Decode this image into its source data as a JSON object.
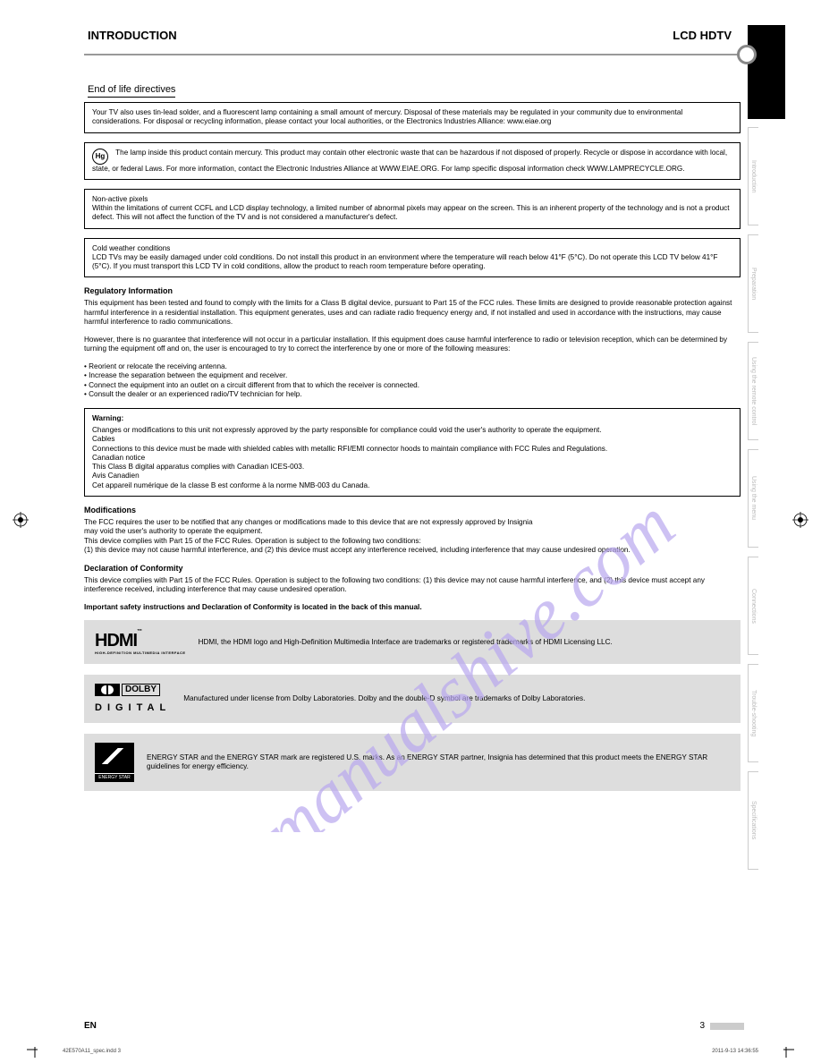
{
  "header": {
    "section": "INTRODUCTION",
    "page_title": "LCD HDTV",
    "sub": "End of life directives"
  },
  "side_tabs": [
    "Introduction",
    "Preparation",
    "Using the remote control",
    "Using the menu",
    "Connections",
    "Trouble-shooting",
    "Specifications"
  ],
  "boxes": {
    "recycle": "Your TV also uses tin-lead solder, and a fluorescent lamp containing a small amount of mercury. Disposal of these materials may be regulated in your community due to environmental considerations. For disposal or recycling information, please contact your local authorities, or the Electronics Industries Alliance: www.eiae.org",
    "hg": "The lamp inside this product contain mercury. This product may contain other electronic waste that can be hazardous if not disposed of properly. Recycle or dispose in accordance with local, state, or federal Laws. For more information, contact the Electronic Industries Alliance at WWW.EIAE.ORG. For lamp specific disposal information check WWW.LAMPRECYCLE.ORG.",
    "nonactive": "Non-active pixels\nWithin the limitations of current CCFL and LCD display technology, a limited number of abnormal pixels may appear on the screen. This is an inherent property of the technology and is not a product defect. This will not affect the function of the TV and is not considered a manufacturer's defect.",
    "cold": "Cold weather conditions\nLCD TVs may be easily damaged under cold conditions. Do not install this product in an environment where the temperature will reach below 41°F (5°C). Do not operate this LCD TV below 41°F (5°C). If you must transport this LCD TV in cold conditions, allow the product to reach room temperature before operating."
  },
  "mid": {
    "fcc_h": "Regulatory Information",
    "fcc1": "This equipment has been tested and found to comply with the limits for a Class B digital device, pursuant to Part 15 of the FCC rules. These limits are designed to provide reasonable protection against harmful interference in a residential installation. This equipment generates, uses and can radiate radio frequency energy and, if not installed and used in accordance with the instructions, may cause harmful interference to radio communications.",
    "fcc2": "However, there is no guarantee that interference will not occur in a particular installation. If this equipment does cause harmful interference to radio or television reception, which can be determined by turning the equipment off and on, the user is encouraged to try to correct the interference by one or more of the following measures:",
    "fcc3": "• Reorient or relocate the receiving antenna.\n• Increase the separation between the equipment and receiver.\n• Connect the equipment into an outlet on a circuit different from that to which the receiver is connected.\n• Consult the dealer or an experienced radio/TV technician for help.",
    "warn_h": "Warning:",
    "warn": "Changes or modifications to this unit not expressly approved by the party responsible for compliance could void the user's authority to operate the equipment.\nCables\nConnections to this device must be made with shielded cables with metallic RFI/EMI connector hoods to maintain compliance with FCC Rules and Regulations.\nCanadian notice\nThis Class B digital apparatus complies with Canadian ICES-003.\nAvis Canadien\nCet appareil numérique de la classe B est conforme à la norme NMB-003 du Canada.",
    "mod_h": "Modifications",
    "mod": "The FCC requires the user to be notified that any changes or modifications made to this device that are not expressly approved by Insignia\nmay void the user's authority to operate the equipment.\nThis device complies with Part 15 of the FCC Rules. Operation is subject to the following two conditions:\n(1) this device may not cause harmful interference, and (2) this device must accept any interference received, including interference that may cause undesired operation.",
    "declare_h": "Declaration of Conformity",
    "declare": "This device complies with Part 15 of the FCC Rules. Operation is subject to the following two conditions: (1) this device may not cause harmful interference, and (2) this device must accept any interference received, including interference that may cause undesired operation.",
    "safety_h": "Important safety instructions and Declaration of Conformity is located in the back of this manual."
  },
  "logos": {
    "hdmi": "HDMI, the HDMI logo and High-Definition Multimedia Interface are trademarks or registered trademarks of HDMI Licensing LLC.",
    "dolby": "Manufactured under license from Dolby Laboratories. Dolby and the double-D symbol are trademarks of Dolby Laboratories.",
    "estar": "ENERGY STAR and the ENERGY STAR mark are registered U.S. marks. As an ENERGY STAR partner, Insignia has determined that this product meets the ENERGY STAR guidelines for energy efficiency."
  },
  "footer": {
    "en": "EN",
    "page": "3",
    "file": "42E570A11_spec.indd   3",
    "date": "2011-9-13   14:36:55"
  },
  "watermark": "manualshive.com"
}
